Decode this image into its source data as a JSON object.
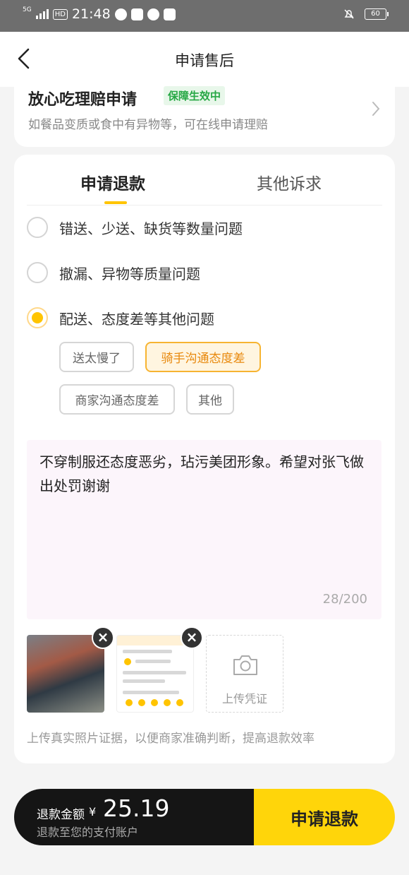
{
  "status_bar": {
    "network": "5G",
    "time": "21:48",
    "hd": "HD",
    "battery": "60"
  },
  "nav": {
    "title": "申请售后"
  },
  "claim": {
    "title": "放心吃理赔申请",
    "badge": "保障生效中",
    "subtitle": "如餐品变质或食中有异物等，可在线申请理赔"
  },
  "tabs": [
    {
      "label": "申请退款",
      "active": true
    },
    {
      "label": "其他诉求",
      "active": false
    }
  ],
  "reasons": [
    {
      "label": "错送、少送、缺货等数量问题",
      "checked": false
    },
    {
      "label": "撤漏、异物等质量问题",
      "checked": false
    },
    {
      "label": "配送、态度差等其他问题",
      "checked": true
    }
  ],
  "chips": [
    {
      "label": "送太慢了",
      "selected": false
    },
    {
      "label": "骑手沟通态度差",
      "selected": true
    },
    {
      "label": "商家沟通态度差",
      "selected": false
    },
    {
      "label": "其他",
      "selected": false
    }
  ],
  "description": {
    "text": "不穿制服还态度恶劣，玷污美团形象。希望对张飞做出处罚谢谢",
    "count": "28/200"
  },
  "upload": {
    "label": "上传凭证",
    "hint": "上传真实照片证据，以便商家准确判断，提高退款效率"
  },
  "footer": {
    "refund_label": "退款金额",
    "currency": "¥",
    "amount": "25.19",
    "sub": "退款至您的支付账户",
    "submit": "申请退款"
  },
  "colors": {
    "accent": "#ffc400",
    "submit_bg": "#ffd50a",
    "badge_green": "#27a845"
  }
}
